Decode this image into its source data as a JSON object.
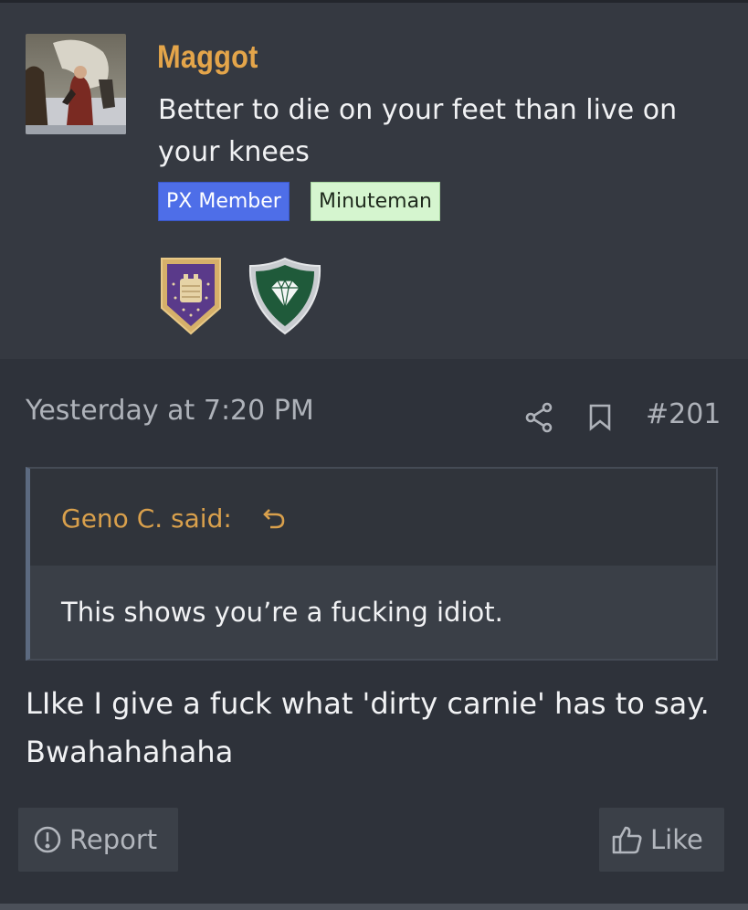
{
  "user": {
    "name": "Maggot",
    "title": "Better to die on your feet than live on your knees",
    "banners": [
      "PX Member",
      "Minuteman"
    ]
  },
  "post": {
    "date": "Yesterday at 7:20 PM",
    "number": "#201",
    "quote": {
      "author_line": "Geno C. said:",
      "text": "This shows you’re a fucking idiot."
    },
    "message": "LIke I give a fuck what 'dirty carnie' has to say. Bwahahahaha"
  },
  "actions": {
    "report": "Report",
    "like": "Like"
  },
  "colors": {
    "username": "#e4a54a",
    "banner_px": "#4e6ee8",
    "banner_minuteman": "#d5f5cf",
    "quote_author": "#d9a04c",
    "background": "#2e323a"
  },
  "icons": [
    "share-icon",
    "bookmark-icon",
    "reply-arrow-icon",
    "alert-circle-icon",
    "thumbs-up-icon"
  ]
}
